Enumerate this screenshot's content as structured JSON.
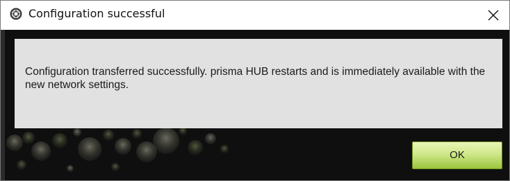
{
  "dialog": {
    "title": "Configuration successful",
    "icon": "gear-circle-icon",
    "close_icon": "close-icon"
  },
  "message": {
    "text": "Configuration transferred successfully. prisma HUB restarts and is immediately available with the new network settings."
  },
  "buttons": {
    "ok_label": "OK"
  },
  "colors": {
    "panel_background": "#e1e1e1",
    "window_background": "#0f0f0f",
    "ok_button_accent": "#b4d85c"
  }
}
